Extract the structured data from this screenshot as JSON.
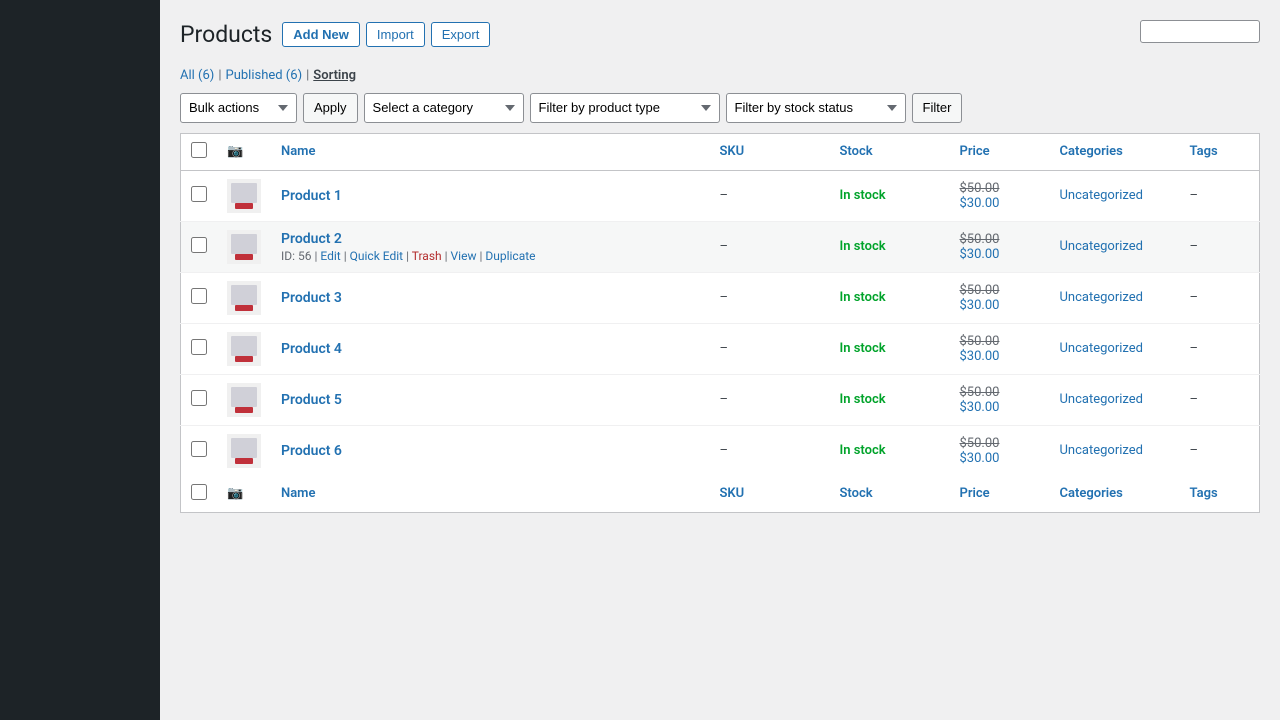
{
  "page": {
    "title": "Products",
    "buttons": {
      "add_new": "Add New",
      "import": "Import",
      "export": "Export"
    }
  },
  "subnav": {
    "all": "All (6)",
    "published": "Published (6)",
    "current": "Sorting"
  },
  "toolbar": {
    "bulk_actions_label": "Bulk actions",
    "apply_label": "Apply",
    "category_placeholder": "Select a category",
    "filter_product_type": "Filter by product type",
    "filter_stock_status": "Filter by stock status",
    "filter_btn": "Filter"
  },
  "table": {
    "headers": {
      "name": "Name",
      "sku": "SKU",
      "stock": "Stock",
      "price": "Price",
      "categories": "Categories",
      "tags": "Tags"
    },
    "products": [
      {
        "id": 1,
        "name": "Product 1",
        "id_num": "55",
        "sku": "–",
        "stock": "In stock",
        "price_original": "$50.00",
        "price_sale": "$30.00",
        "categories": "Uncategorized",
        "tags": "–",
        "hovered": false
      },
      {
        "id": 2,
        "name": "Product 2",
        "id_num": "56",
        "sku": "–",
        "stock": "In stock",
        "price_original": "$50.00",
        "price_sale": "$30.00",
        "categories": "Uncategorized",
        "tags": "–",
        "hovered": true
      },
      {
        "id": 3,
        "name": "Product 3",
        "id_num": "57",
        "sku": "–",
        "stock": "In stock",
        "price_original": "$50.00",
        "price_sale": "$30.00",
        "categories": "Uncategorized",
        "tags": "–",
        "hovered": false
      },
      {
        "id": 4,
        "name": "Product 4",
        "id_num": "58",
        "sku": "–",
        "stock": "In stock",
        "price_original": "$50.00",
        "price_sale": "$30.00",
        "categories": "Uncategorized",
        "tags": "–",
        "hovered": false
      },
      {
        "id": 5,
        "name": "Product 5",
        "id_num": "59",
        "sku": "–",
        "stock": "In stock",
        "price_original": "$50.00",
        "price_sale": "$30.00",
        "categories": "Uncategorized",
        "tags": "–",
        "hovered": false
      },
      {
        "id": 6,
        "name": "Product 6",
        "id_num": "60",
        "sku": "",
        "stock": "In stock",
        "price_original": "$50.00",
        "price_sale": "$30.00",
        "categories": "Uncategorized",
        "tags": "",
        "hovered": false
      }
    ]
  },
  "row_actions": {
    "id_prefix": "ID:",
    "edit": "Edit",
    "quick_edit": "Quick Edit",
    "trash": "Trash",
    "view": "View",
    "duplicate": "Duplicate"
  },
  "colors": {
    "in_stock": "#00a32a",
    "link": "#2271b1",
    "trash": "#b32d2e"
  }
}
